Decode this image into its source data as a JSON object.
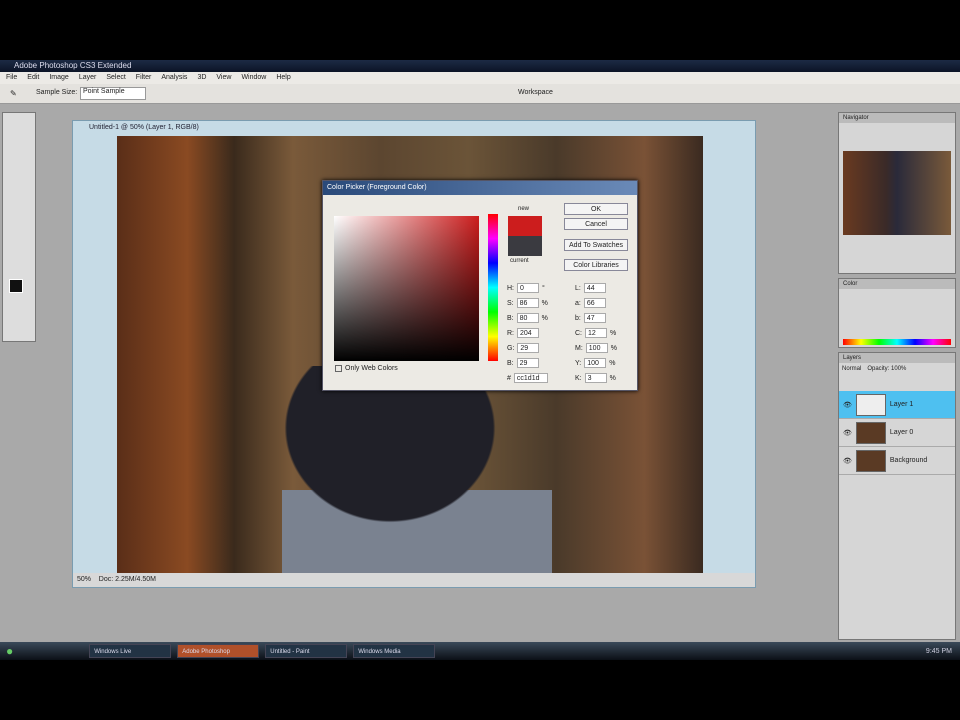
{
  "app": {
    "title": "Adobe Photoshop CS3 Extended"
  },
  "menu": [
    "File",
    "Edit",
    "Image",
    "Layer",
    "Select",
    "Filter",
    "Analysis",
    "3D",
    "View",
    "Window",
    "Help"
  ],
  "options": {
    "sample_label": "Sample Size:",
    "sample_value": "Point Sample",
    "workspace": "Workspace"
  },
  "document": {
    "title": "Untitled-1 @ 50% (Layer 1, RGB/8)",
    "zoom": "50%",
    "doc_info": "Doc: 2.25M/4.50M"
  },
  "color_picker": {
    "title": "Color Picker (Foreground Color)",
    "new_label": "new",
    "current_label": "current",
    "ok": "OK",
    "cancel": "Cancel",
    "add_swatches": "Add To Swatches",
    "color_libraries": "Color Libraries",
    "web_only": "Only Web Colors",
    "fields": [
      {
        "l": "H:",
        "v": "0",
        "u": "°"
      },
      {
        "l": "S:",
        "v": "86",
        "u": "%"
      },
      {
        "l": "B:",
        "v": "80",
        "u": "%"
      },
      {
        "l": "R:",
        "v": "204",
        "u": ""
      },
      {
        "l": "G:",
        "v": "29",
        "u": ""
      },
      {
        "l": "B:",
        "v": "29",
        "u": ""
      }
    ],
    "lab": [
      {
        "l": "L:",
        "v": "44"
      },
      {
        "l": "a:",
        "v": "66"
      },
      {
        "l": "b:",
        "v": "47"
      }
    ],
    "cmyk": [
      {
        "l": "C:",
        "v": "12",
        "u": "%"
      },
      {
        "l": "M:",
        "v": "100",
        "u": "%"
      },
      {
        "l": "Y:",
        "v": "100",
        "u": "%"
      },
      {
        "l": "K:",
        "v": "3",
        "u": "%"
      }
    ],
    "hex": "cc1d1d",
    "new_color": "#cc1d1d",
    "current_color": "#3a3a40"
  },
  "panels": {
    "navigator": "Navigator",
    "color": "Color",
    "layers": "Layers",
    "blend": "Normal",
    "opacity": "Opacity: 100%",
    "layers_list": [
      {
        "name": "Layer 1",
        "selected": true
      },
      {
        "name": "Layer 0",
        "selected": false
      },
      {
        "name": "Background",
        "selected": false
      }
    ]
  },
  "taskbar": {
    "items": [
      "Windows Live",
      "Adobe Photoshop",
      "Untitled - Paint",
      "Windows Media"
    ],
    "clock": "9:45 PM"
  }
}
